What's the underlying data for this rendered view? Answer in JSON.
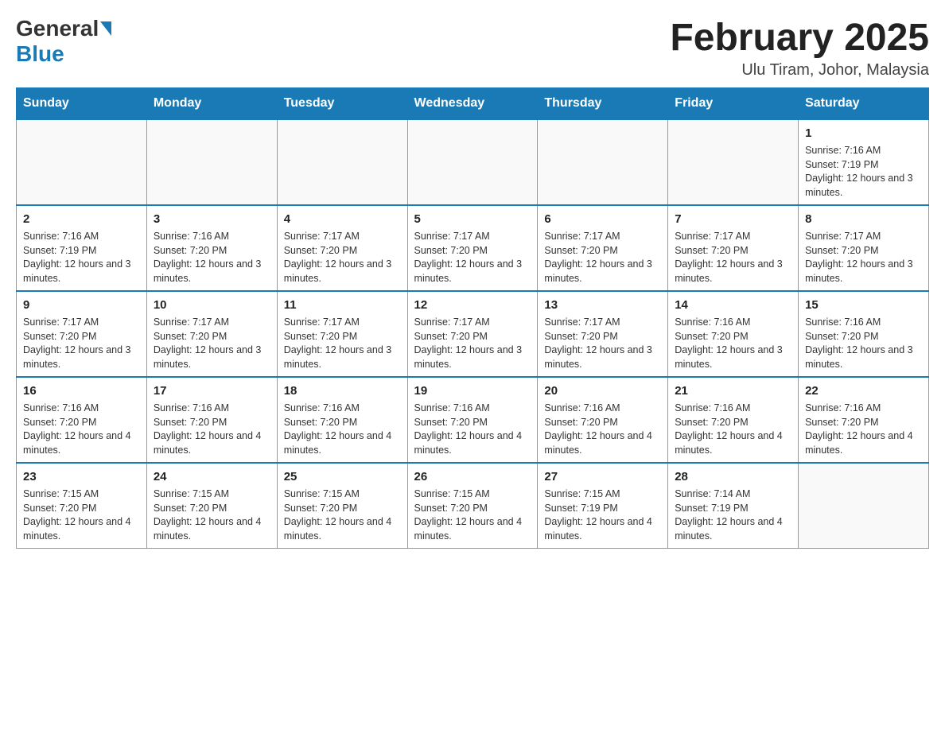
{
  "header": {
    "logo_general": "General",
    "logo_blue": "Blue",
    "month_year": "February 2025",
    "location": "Ulu Tiram, Johor, Malaysia"
  },
  "days_of_week": [
    "Sunday",
    "Monday",
    "Tuesday",
    "Wednesday",
    "Thursday",
    "Friday",
    "Saturday"
  ],
  "weeks": [
    [
      {
        "day": "",
        "info": ""
      },
      {
        "day": "",
        "info": ""
      },
      {
        "day": "",
        "info": ""
      },
      {
        "day": "",
        "info": ""
      },
      {
        "day": "",
        "info": ""
      },
      {
        "day": "",
        "info": ""
      },
      {
        "day": "1",
        "info": "Sunrise: 7:16 AM\nSunset: 7:19 PM\nDaylight: 12 hours and 3 minutes."
      }
    ],
    [
      {
        "day": "2",
        "info": "Sunrise: 7:16 AM\nSunset: 7:19 PM\nDaylight: 12 hours and 3 minutes."
      },
      {
        "day": "3",
        "info": "Sunrise: 7:16 AM\nSunset: 7:20 PM\nDaylight: 12 hours and 3 minutes."
      },
      {
        "day": "4",
        "info": "Sunrise: 7:17 AM\nSunset: 7:20 PM\nDaylight: 12 hours and 3 minutes."
      },
      {
        "day": "5",
        "info": "Sunrise: 7:17 AM\nSunset: 7:20 PM\nDaylight: 12 hours and 3 minutes."
      },
      {
        "day": "6",
        "info": "Sunrise: 7:17 AM\nSunset: 7:20 PM\nDaylight: 12 hours and 3 minutes."
      },
      {
        "day": "7",
        "info": "Sunrise: 7:17 AM\nSunset: 7:20 PM\nDaylight: 12 hours and 3 minutes."
      },
      {
        "day": "8",
        "info": "Sunrise: 7:17 AM\nSunset: 7:20 PM\nDaylight: 12 hours and 3 minutes."
      }
    ],
    [
      {
        "day": "9",
        "info": "Sunrise: 7:17 AM\nSunset: 7:20 PM\nDaylight: 12 hours and 3 minutes."
      },
      {
        "day": "10",
        "info": "Sunrise: 7:17 AM\nSunset: 7:20 PM\nDaylight: 12 hours and 3 minutes."
      },
      {
        "day": "11",
        "info": "Sunrise: 7:17 AM\nSunset: 7:20 PM\nDaylight: 12 hours and 3 minutes."
      },
      {
        "day": "12",
        "info": "Sunrise: 7:17 AM\nSunset: 7:20 PM\nDaylight: 12 hours and 3 minutes."
      },
      {
        "day": "13",
        "info": "Sunrise: 7:17 AM\nSunset: 7:20 PM\nDaylight: 12 hours and 3 minutes."
      },
      {
        "day": "14",
        "info": "Sunrise: 7:16 AM\nSunset: 7:20 PM\nDaylight: 12 hours and 3 minutes."
      },
      {
        "day": "15",
        "info": "Sunrise: 7:16 AM\nSunset: 7:20 PM\nDaylight: 12 hours and 3 minutes."
      }
    ],
    [
      {
        "day": "16",
        "info": "Sunrise: 7:16 AM\nSunset: 7:20 PM\nDaylight: 12 hours and 4 minutes."
      },
      {
        "day": "17",
        "info": "Sunrise: 7:16 AM\nSunset: 7:20 PM\nDaylight: 12 hours and 4 minutes."
      },
      {
        "day": "18",
        "info": "Sunrise: 7:16 AM\nSunset: 7:20 PM\nDaylight: 12 hours and 4 minutes."
      },
      {
        "day": "19",
        "info": "Sunrise: 7:16 AM\nSunset: 7:20 PM\nDaylight: 12 hours and 4 minutes."
      },
      {
        "day": "20",
        "info": "Sunrise: 7:16 AM\nSunset: 7:20 PM\nDaylight: 12 hours and 4 minutes."
      },
      {
        "day": "21",
        "info": "Sunrise: 7:16 AM\nSunset: 7:20 PM\nDaylight: 12 hours and 4 minutes."
      },
      {
        "day": "22",
        "info": "Sunrise: 7:16 AM\nSunset: 7:20 PM\nDaylight: 12 hours and 4 minutes."
      }
    ],
    [
      {
        "day": "23",
        "info": "Sunrise: 7:15 AM\nSunset: 7:20 PM\nDaylight: 12 hours and 4 minutes."
      },
      {
        "day": "24",
        "info": "Sunrise: 7:15 AM\nSunset: 7:20 PM\nDaylight: 12 hours and 4 minutes."
      },
      {
        "day": "25",
        "info": "Sunrise: 7:15 AM\nSunset: 7:20 PM\nDaylight: 12 hours and 4 minutes."
      },
      {
        "day": "26",
        "info": "Sunrise: 7:15 AM\nSunset: 7:20 PM\nDaylight: 12 hours and 4 minutes."
      },
      {
        "day": "27",
        "info": "Sunrise: 7:15 AM\nSunset: 7:19 PM\nDaylight: 12 hours and 4 minutes."
      },
      {
        "day": "28",
        "info": "Sunrise: 7:14 AM\nSunset: 7:19 PM\nDaylight: 12 hours and 4 minutes."
      },
      {
        "day": "",
        "info": ""
      }
    ]
  ]
}
